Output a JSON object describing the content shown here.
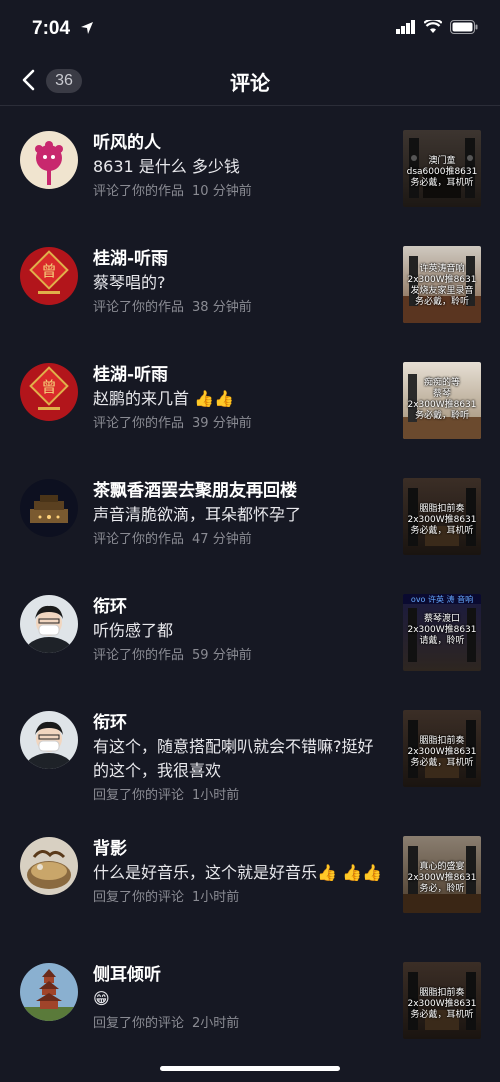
{
  "status": {
    "time": "7:04"
  },
  "header": {
    "back_count": "36",
    "title": "评论"
  },
  "items": [
    {
      "name": "听风的人",
      "comment": "8631 是什么  多少钱",
      "action": "评论了你的作品",
      "time": "10 分钟前",
      "thumb": "澳门童\ndsa6000推8631\n务必戴，耳机听"
    },
    {
      "name": "桂湖-听雨",
      "comment": "蔡琴唱的?",
      "action": "评论了你的作品",
      "time": "38 分钟前",
      "thumb": "许英涛音响\n2x300W推8631\n发烧友家里录音\n务必戴，聆听"
    },
    {
      "name": "桂湖-听雨",
      "comment": "赵鹏的来几首",
      "action": "评论了你的作品",
      "time": "39 分钟前",
      "thumb": "痴痴的等\n蔡琴\n2x300W推8631\n务必戴，聆听"
    },
    {
      "name": "茶飘香酒罢去聚朋友再回楼",
      "comment": "声音清脆欲滴，耳朵都怀孕了",
      "action": "评论了你的作品",
      "time": "47 分钟前",
      "thumb": "胭脂扣前奏\n2x300W推8631\n务必戴，耳机听"
    },
    {
      "name": "衔环",
      "comment": "听伤感了都",
      "action": "评论了你的作品",
      "time": "59 分钟前",
      "thumb": "蔡琴渡口\n2x300W推8631\n请戴，聆听"
    },
    {
      "name": "衔环",
      "comment": "有这个，随意搭配喇叭就会不错嘛?挺好的这个，我很喜欢",
      "action": "回复了你的评论",
      "time": "1小时前",
      "thumb": "胭脂扣前奏\n2x300W推8631\n务必戴，耳机听"
    },
    {
      "name": "背影",
      "comment": "什么是好音乐，这个就是好音乐",
      "action": "回复了你的评论",
      "time": "1小时前",
      "thumb": "真心的盛宴\n2x300W推8631\n务必，聆听"
    },
    {
      "name": "侧耳倾听",
      "comment": "😁",
      "action": "回复了你的评论",
      "time": "2小时前",
      "thumb": "胭脂扣前奏\n2x300W推8631\n务必戴，耳机听"
    }
  ],
  "colors": {
    "background": "#161823",
    "meta": "#8a8b93",
    "badge": "#3a3b45"
  }
}
